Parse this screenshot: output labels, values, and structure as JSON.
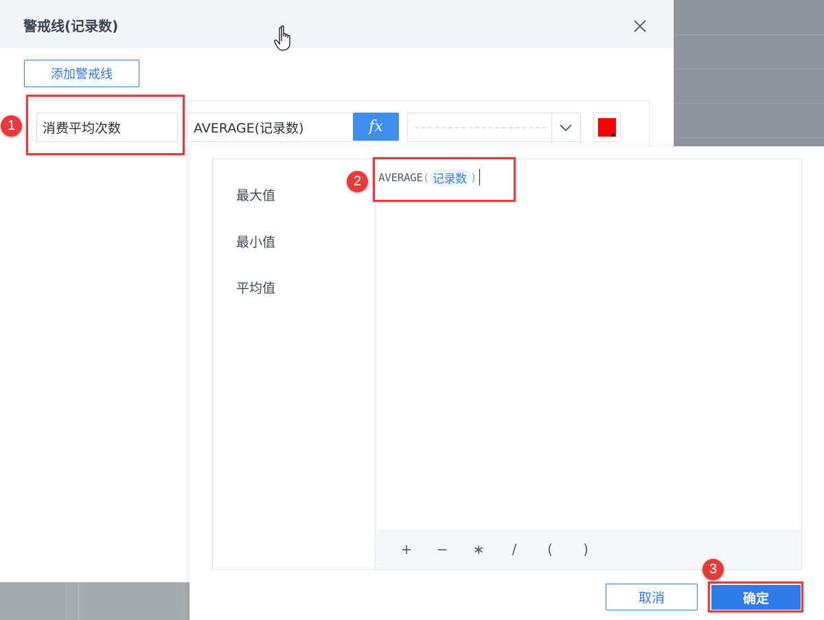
{
  "dialog": {
    "title": "警戒线(记录数)",
    "add_button_label": "添加警戒线"
  },
  "warning_line": {
    "name": "消费平均次数",
    "formula": "AVERAGE(记录数)",
    "fx_label": "fx",
    "line_style": "dashed",
    "color": "#ff0000"
  },
  "formula_editor": {
    "functions": [
      "最大值",
      "最小值",
      "平均值"
    ],
    "expression": {
      "func": "AVERAGE",
      "open_paren": "(",
      "field": "记录数",
      "close_paren": ")"
    },
    "operators": [
      "+",
      "−",
      "∗",
      "/",
      "(",
      ")"
    ]
  },
  "actions": {
    "cancel_label": "取消",
    "confirm_label": "确定"
  },
  "annotations": {
    "step1": "1",
    "step2": "2",
    "step3": "3",
    "color": "#e8393b"
  },
  "colors": {
    "accent": "#2f7bea",
    "fx_button": "#3e8ef0"
  }
}
